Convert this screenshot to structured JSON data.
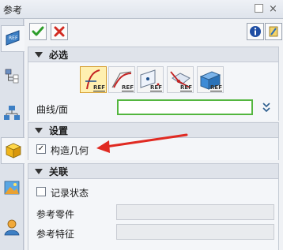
{
  "window": {
    "title": "参考"
  },
  "toolbar": {
    "ok_icon": "check-icon",
    "cancel_icon": "x-icon",
    "info_icon": "info-icon",
    "help_icon": "help-icon"
  },
  "sections": {
    "required": {
      "label": "必选"
    },
    "settings": {
      "label": "设置"
    },
    "association": {
      "label": "关联"
    }
  },
  "ref_buttons": [
    {
      "tag": "REF",
      "icon": "curve-ref-icon",
      "selected": true
    },
    {
      "tag": "REF",
      "icon": "spline-ref-icon",
      "selected": false
    },
    {
      "tag": "REF",
      "icon": "point-ref-icon",
      "selected": false
    },
    {
      "tag": "REF",
      "icon": "plane-ref-icon",
      "selected": false
    },
    {
      "tag": "REF",
      "icon": "face-ref-icon",
      "selected": false
    }
  ],
  "fields": {
    "curve_face": {
      "label": "曲线/面",
      "value": ""
    },
    "construct_geometry": {
      "label": "构造几何",
      "checked": true
    },
    "record_state": {
      "label": "记录状态",
      "checked": false
    },
    "ref_part": {
      "label": "参考零件",
      "value": ""
    },
    "ref_feature": {
      "label": "参考特征",
      "value": ""
    }
  },
  "leftbar": {
    "items": [
      "ref-tab-icon",
      "tree-icon",
      "hierarchy-icon",
      "cube-icon",
      "image-icon",
      "user-icon"
    ]
  },
  "colors": {
    "accent_green": "#53b63f",
    "annotation_red": "#e02a22",
    "selected_bg": "#fff0b0"
  }
}
